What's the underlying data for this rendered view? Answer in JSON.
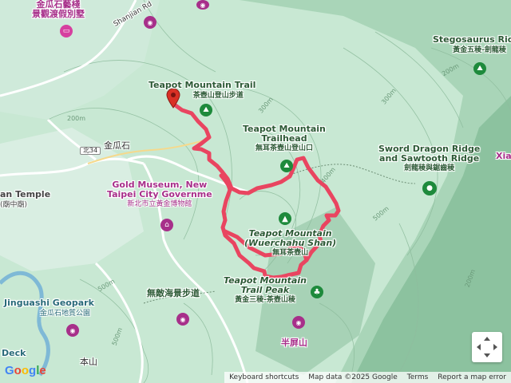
{
  "map": {
    "type": "terrain",
    "places": {
      "villa_zh_1": "金瓜石藝棧",
      "villa_zh_2": "景觀渡假別墅",
      "shanjian_rd": "Shanjian Rd",
      "teapot_trail_en": "Teapot Mountain Trail",
      "teapot_trail_zh": "茶壺山登山步道",
      "teapot_trailhead_en_1": "Teapot Mountain",
      "teapot_trailhead_en_2": "Trailhead",
      "teapot_trailhead_zh": "無耳茶壺山登山口",
      "jinguashi": "金瓜石",
      "road_north34": "北34",
      "temple_en": "an Temple",
      "temple_zh": "(廟中廟)",
      "gold_museum_en_1": "Gold Museum, New",
      "gold_museum_en_2": "Taipei City Governme",
      "gold_museum_zh": "新北市立黃金博物館",
      "teapot_mtn_en_1": "Teapot Mountain",
      "teapot_mtn_en_2": "(Wuerchahu Shan)",
      "teapot_mtn_zh": "無耳茶壺山",
      "teapot_peak_en_1": "Teapot Mountain",
      "teapot_peak_en_2": "Trail Peak",
      "teapot_peak_zh": "黃金三稜-茶壺山稜",
      "wudi_trail": "無敵海景步道",
      "banping": "半屏山",
      "geopark_en": "Jinguashi Geopark",
      "geopark_zh": "金瓜石地質公園",
      "deck": "Deck",
      "benshan": "本山",
      "stegosaurus_en": "Stegosaurus Ridge",
      "stegosaurus_zh": "黃金五稜-劍龍稜",
      "sword_en_1": "Sword Dragon Ridge",
      "sword_en_2": "and Sawtooth Ridge",
      "sword_zh": "劍龍稜與鋸齒稜",
      "xia": "Xia"
    },
    "contours": {
      "c200a": "200m",
      "c200b": "200m",
      "c300a": "300m",
      "c300b": "300m",
      "c400a": "400m",
      "c500a": "500m",
      "c500b": "500m",
      "c500c": "500m",
      "c200c": "200m"
    },
    "route_color": "#e94560",
    "accent_green": "#1e8a3c",
    "accent_purple": "#a72f8a"
  },
  "footer": {
    "shortcuts": "Keyboard shortcuts",
    "mapdata": "Map data ©2025 Google",
    "terms": "Terms",
    "report": "Report a map error"
  },
  "logo": "Google"
}
